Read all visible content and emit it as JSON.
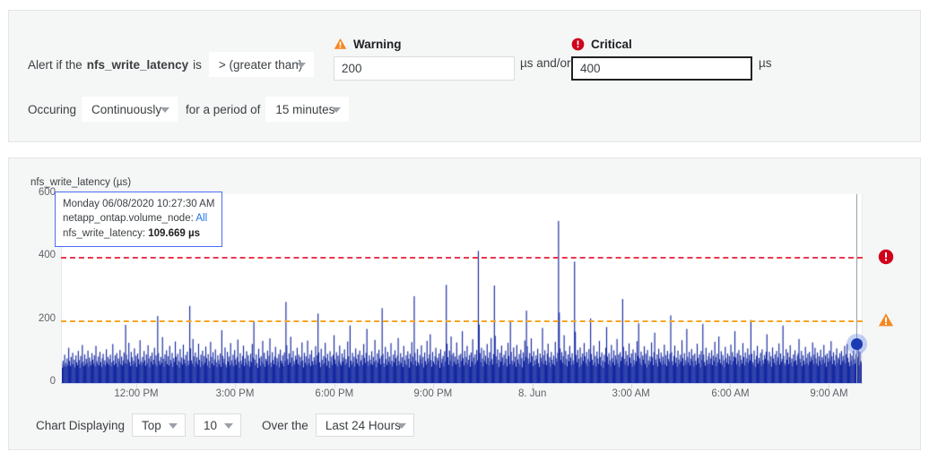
{
  "alert_form": {
    "prefix": "Alert if the",
    "metric": "nfs_write_latency",
    "is_label": "is",
    "operator": "> (greater than)",
    "occuring_label": "Occuring",
    "occurrence": "Continuously",
    "period_label": "for a period of",
    "period": "15 minutes",
    "warning": {
      "icon": "warning-triangle-icon",
      "label": "Warning",
      "value": "200",
      "unit": "µs",
      "color": "#F5871F"
    },
    "and_or": "µs and/or",
    "critical": {
      "icon": "critical-circle-icon",
      "label": "Critical",
      "value": "400",
      "unit": "µs",
      "color": "#D0021B"
    }
  },
  "chart_controls": {
    "displaying_label": "Chart Displaying",
    "rank": "Top",
    "count": "10",
    "over_the_label": "Over the",
    "range": "Last 24 Hours"
  },
  "tooltip": {
    "timestamp": "Monday 06/08/2020 10:27:30 AM",
    "dimension_label": "netapp_ontap.volume_node:",
    "dimension_value": "All",
    "metric_label": "nfs_write_latency:",
    "metric_value": "109.669 µs"
  },
  "chart_data": {
    "type": "area",
    "title": "nfs_write_latency (µs)",
    "xlabel": "",
    "ylabel": "nfs_write_latency (µs)",
    "ylim": [
      0,
      600
    ],
    "yticks": [
      0,
      200,
      400,
      600
    ],
    "xtick_labels": [
      "12:00 PM",
      "3:00 PM",
      "6:00 PM",
      "9:00 PM",
      "8. Jun",
      "3:00 AM",
      "6:00 AM",
      "9:00 AM"
    ],
    "xtick_positions": [
      0.094,
      0.217,
      0.341,
      0.464,
      0.588,
      0.711,
      0.835,
      0.958
    ],
    "grid": false,
    "legend": "none",
    "series_name": "nfs_write_latency",
    "series_color": "#1428A0",
    "thresholds": [
      {
        "name": "critical",
        "value": 400,
        "color": "#E8384F",
        "style": "dashed"
      },
      {
        "name": "warning",
        "value": 200,
        "color": "#F5A623",
        "style": "dashed"
      }
    ],
    "hover_point": {
      "x_fraction": 0.993,
      "value": 109.669
    },
    "values": [
      62,
      48,
      71,
      55,
      90,
      64,
      52,
      78,
      58,
      112,
      70,
      54,
      83,
      61,
      96,
      59,
      74,
      50,
      88,
      66,
      57,
      102,
      73,
      49,
      86,
      62,
      121,
      68,
      54,
      91,
      59,
      77,
      64,
      103,
      52,
      81,
      69,
      57,
      95,
      74,
      61,
      88,
      53,
      118,
      70,
      62,
      84,
      56,
      99,
      67,
      51,
      79,
      93,
      60,
      72,
      55,
      107,
      64,
      83,
      58,
      76,
      90,
      53,
      66,
      124,
      71,
      57,
      88,
      62,
      95,
      51,
      78,
      69,
      105,
      60,
      84,
      56,
      72,
      97,
      63,
      185,
      90,
      61,
      75,
      128,
      67,
      54,
      99,
      82,
      58,
      71,
      110,
      64,
      87,
      52,
      94,
      76,
      60,
      136,
      69,
      57,
      83,
      65,
      102,
      72,
      55,
      91,
      63,
      120,
      78,
      50,
      86,
      68,
      97,
      59,
      74,
      112,
      61,
      88,
      53,
      213,
      95,
      70,
      58,
      83,
      64,
      146,
      77,
      52,
      91,
      69,
      104,
      60,
      85,
      56,
      118,
      73,
      62,
      96,
      51,
      79,
      67,
      132,
      84,
      57,
      93,
      70,
      49,
      108,
      66,
      81,
      59,
      122,
      75,
      63,
      89,
      54,
      100,
      71,
      58,
      245,
      110,
      72,
      61,
      140,
      85,
      53,
      97,
      67,
      82,
      59,
      125,
      74,
      51,
      90,
      68,
      103,
      57,
      86,
      64,
      116,
      79,
      55,
      92,
      70,
      48,
      131,
      83,
      62,
      98,
      56,
      75,
      107,
      66,
      51,
      88,
      73,
      60,
      94,
      52,
      168,
      86,
      64,
      77,
      113,
      59,
      50,
      99,
      68,
      84,
      56,
      127,
      72,
      61,
      90,
      53,
      105,
      75,
      58,
      82,
      138,
      67,
      49,
      95,
      71,
      60,
      86,
      119,
      54,
      78,
      64,
      101,
      57,
      88,
      70,
      52,
      93,
      66,
      124,
      80,
      196,
      74,
      57,
      91,
      63,
      48,
      109,
      79,
      55,
      85,
      68,
      134,
      61,
      96,
      52,
      77,
      70,
      103,
      58,
      87,
      142,
      65,
      51,
      98,
      73,
      60,
      84,
      115,
      56,
      79,
      67,
      92,
      50,
      106,
      71,
      63,
      88,
      54,
      97,
      69,
      258,
      120,
      76,
      58,
      94,
      65,
      147,
      81,
      53,
      102,
      70,
      59,
      87,
      75,
      112,
      61,
      90,
      56,
      83,
      68,
      129,
      72,
      50,
      96,
      64,
      85,
      57,
      135,
      78,
      62,
      91,
      54,
      104,
      69,
      58,
      82,
      73,
      117,
      60,
      88,
      221,
      97,
      66,
      51,
      109,
      74,
      59,
      86,
      63,
      128,
      80,
      55,
      93,
      70,
      48,
      101,
      67,
      84,
      57,
      90,
      152,
      75,
      61,
      98,
      53,
      87,
      72,
      119,
      64,
      56,
      94,
      69,
      81,
      107,
      58,
      76,
      63,
      132,
      85,
      50,
      183,
      71,
      59,
      96,
      67,
      84,
      52,
      110,
      77,
      62,
      91,
      55,
      103,
      68,
      73,
      89,
      57,
      124,
      80,
      64,
      96,
      172,
      69,
      55,
      88,
      74,
      61,
      101,
      58,
      83,
      67,
      137,
      72,
      50,
      94,
      65,
      106,
      78,
      59,
      86,
      238,
      92,
      63,
      51,
      115,
      76,
      57,
      99,
      68,
      84,
      60,
      127,
      71,
      53,
      90,
      66,
      104,
      79,
      55,
      87,
      143,
      70,
      58,
      95,
      64,
      82,
      51,
      118,
      73,
      61,
      88,
      56,
      101,
      77,
      49,
      93,
      67,
      130,
      84,
      59,
      276,
      96,
      71,
      54,
      108,
      65,
      57,
      89,
      76,
      120,
      62,
      83,
      50,
      97,
      70,
      59,
      134,
      78,
      66,
      91,
      155,
      73,
      52,
      99,
      68,
      60,
      85,
      112,
      57,
      80,
      71,
      94,
      48,
      107,
      64,
      77,
      86,
      53,
      101,
      69,
      312,
      125,
      82,
      58,
      103,
      71,
      148,
      90,
      54,
      96,
      67,
      84,
      59,
      129,
      75,
      62,
      88,
      51,
      93,
      70,
      165,
      79,
      56,
      102,
      65,
      83,
      118,
      60,
      74,
      89,
      52,
      97,
      68,
      139,
      81,
      57,
      91,
      63,
      105,
      72,
      420,
      186,
      95,
      66,
      112,
      78,
      53,
      104,
      70,
      87,
      61,
      124,
      80,
      56,
      98,
      69,
      143,
      76,
      59,
      92,
      310,
      150,
      85,
      62,
      107,
      74,
      51,
      96,
      68,
      119,
      81,
      57,
      90,
      64,
      103,
      77,
      53,
      128,
      86,
      60,
      195,
      99,
      71,
      58,
      113,
      67,
      84,
      52,
      121,
      75,
      63,
      92,
      56,
      106,
      79,
      50,
      97,
      70,
      135,
      83,
      230,
      117,
      78,
      61,
      95,
      66,
      142,
      85,
      54,
      101,
      72,
      58,
      88,
      76,
      109,
      63,
      51,
      94,
      80,
      67,
      175,
      88,
      60,
      104,
      71,
      57,
      93,
      125,
      65,
      82,
      52,
      99,
      74,
      61,
      87,
      56,
      131,
      79,
      68,
      96,
      515,
      224,
      110,
      73,
      98,
      64,
      85,
      152,
      59,
      102,
      76,
      53,
      91,
      69,
      118,
      81,
      57,
      95,
      72,
      60,
      386,
      163,
      89,
      66,
      105,
      77,
      51,
      113,
      82,
      58,
      94,
      70,
      127,
      85,
      62,
      99,
      54,
      76,
      108,
      68,
      205,
      92,
      74,
      57,
      119,
      65,
      86,
      53,
      100,
      78,
      61,
      134,
      83,
      55,
      97,
      71,
      48,
      90,
      67,
      112,
      178,
      84,
      60,
      95,
      72,
      53,
      121,
      79,
      66,
      104,
      57,
      88,
      75,
      140,
      62,
      91,
      51,
      98,
      70,
      83,
      267,
      115,
      77,
      59,
      102,
      68,
      89,
      55,
      126,
      81,
      63,
      94,
      52,
      107,
      73,
      58,
      96,
      69,
      133,
      86,
      190,
      79,
      64,
      100,
      56,
      87,
      74,
      117,
      61,
      93,
      50,
      105,
      72,
      59,
      85,
      68,
      129,
      82,
      57,
      98,
      160,
      75,
      62,
      91,
      53,
      109,
      78,
      66,
      97,
      58,
      84,
      71,
      122,
      60,
      89,
      54,
      102,
      76,
      67,
      93,
      215,
      98,
      70,
      57,
      86,
      119,
      64,
      81,
      52,
      103,
      75,
      61,
      90,
      68,
      136,
      79,
      55,
      95,
      72,
      60,
      172,
      83,
      65,
      99,
      56,
      77,
      108,
      69,
      88,
      53,
      94,
      71,
      58,
      125,
      80,
      63,
      91,
      50,
      102,
      74,
      188,
      90,
      67,
      55,
      112,
      73,
      59,
      85,
      96,
      62,
      78,
      104,
      57,
      87,
      70,
      131,
      82,
      54,
      93,
      66,
      148,
      76,
      63,
      101,
      58,
      89,
      72,
      50,
      115,
      79,
      65,
      94,
      60,
      86,
      73,
      122,
      57,
      98,
      69,
      84,
      165,
      81,
      59,
      95,
      70,
      105,
      53,
      88,
      74,
      62,
      127,
      83,
      56,
      97,
      68,
      79,
      110,
      64,
      90,
      72,
      200,
      93,
      66,
      58,
      103,
      75,
      51,
      87,
      118,
      62,
      80,
      70,
      96,
      55,
      107,
      73,
      61,
      89,
      77,
      100,
      155,
      72,
      60,
      99,
      67,
      85,
      52,
      113,
      78,
      64,
      91,
      57,
      102,
      70,
      82,
      126,
      59,
      94,
      68,
      76,
      183,
      86,
      63,
      56,
      108,
      74,
      97,
      60,
      82,
      120,
      65,
      78,
      53,
      91,
      69,
      104,
      72,
      58,
      87,
      95,
      140,
      77,
      65,
      102,
      54,
      88,
      71,
      59,
      115,
      80,
      63,
      93,
      57,
      99,
      68,
      84,
      73,
      129,
      61,
      90,
      112,
      78,
      62,
      97,
      55,
      85,
      70,
      106,
      59,
      82,
      74,
      121,
      64,
      88,
      52,
      94,
      67,
      79,
      103,
      71,
      133,
      85,
      60,
      98,
      72,
      56,
      89,
      110,
      63,
      81,
      75,
      95,
      58,
      102,
      69,
      86,
      73,
      118,
      62,
      91,
      124,
      80,
      66,
      54,
      95,
      71,
      87,
      58,
      104,
      76,
      61,
      92,
      69,
      83,
      113,
      57,
      99,
      70,
      64,
      110
    ]
  }
}
